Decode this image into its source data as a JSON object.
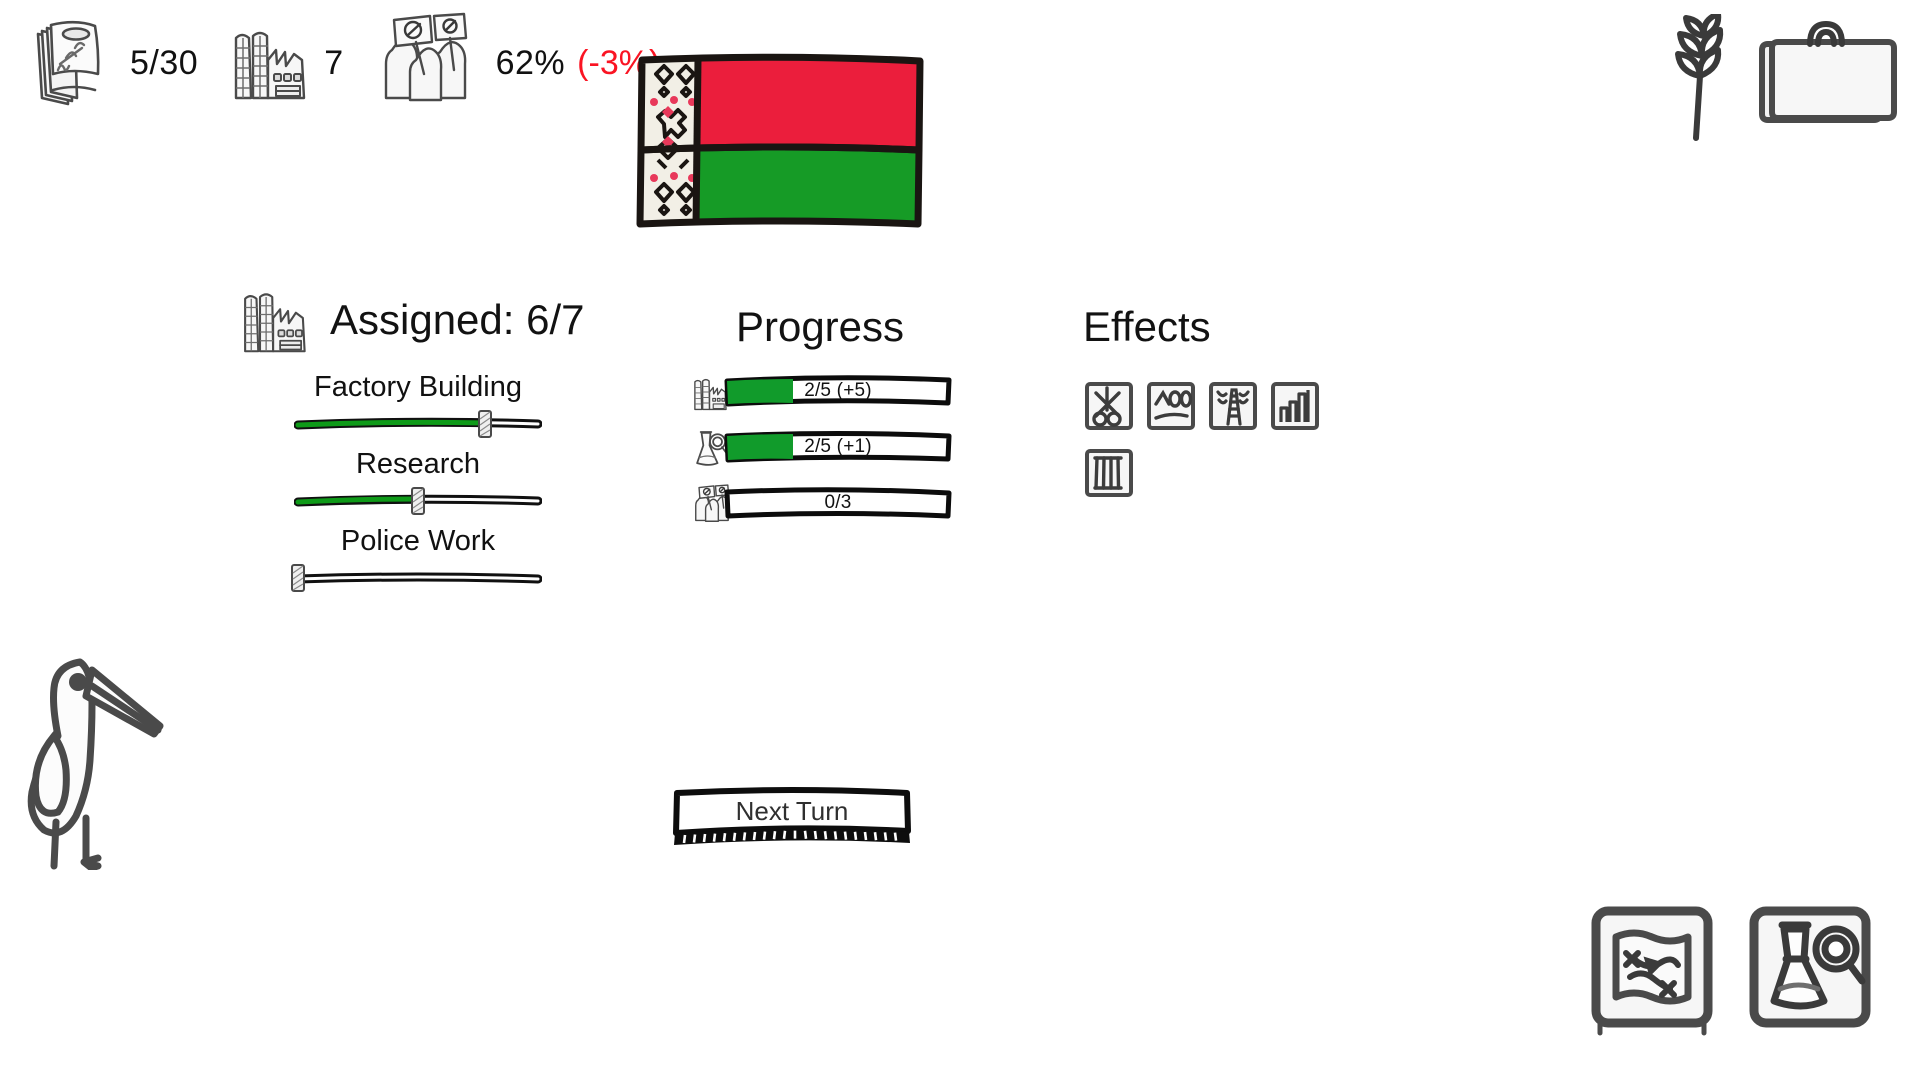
{
  "topbar": {
    "resources": [
      {
        "icon": "money-stack-icon",
        "name": "money",
        "value": "5/30",
        "delta": ""
      },
      {
        "icon": "factory-icon",
        "name": "factories",
        "value": "7",
        "delta": ""
      },
      {
        "icon": "protesters-icon",
        "name": "approval",
        "value": "62%",
        "delta": "(-3%)"
      }
    ],
    "delta_color": "#fa1423"
  },
  "flag": {
    "name": "belarus-flag",
    "red": "#eb1e3c",
    "green": "#169b26",
    "ornament_bg": "#f2efe6",
    "outline": "#1a1512"
  },
  "top_right_icons": [
    {
      "name": "wheat-icon",
      "label": "Agriculture"
    },
    {
      "name": "briefcase-icon",
      "label": "Economy"
    }
  ],
  "assigned": {
    "icon": "factory-icon",
    "title": "Assigned: 6/7",
    "sliders": [
      {
        "name": "factory-building",
        "label": "Factory Building",
        "fill": 0.77
      },
      {
        "name": "research",
        "label": "Research",
        "fill": 0.5
      },
      {
        "name": "police-work",
        "label": "Police Work",
        "fill": 0.0
      }
    ],
    "fill_color": "#0e9a18"
  },
  "progress": {
    "title": "Progress",
    "rows": [
      {
        "name": "factory-progress",
        "icon": "factory-icon",
        "text": "2/5 (+5)",
        "fill": 0.3
      },
      {
        "name": "research-progress",
        "icon": "research-icon",
        "text": "2/5 (+1)",
        "fill": 0.3
      },
      {
        "name": "protest-progress",
        "icon": "protesters-icon",
        "text": "0/3",
        "fill": 0.0
      }
    ],
    "fill_color": "#119b2b"
  },
  "effects": {
    "title": "Effects",
    "items": [
      {
        "name": "effect-scissors-icon",
        "label": "Cuts"
      },
      {
        "name": "effect-hills-icon",
        "label": "Landscape"
      },
      {
        "name": "effect-tower-icon",
        "label": "Tower"
      },
      {
        "name": "effect-industry-icon",
        "label": "Industry"
      },
      {
        "name": "effect-prison-icon",
        "label": "Prison"
      }
    ]
  },
  "stork": {
    "name": "stork-illustration"
  },
  "next_turn": {
    "label": "Next Turn"
  },
  "bottom_right_icons": [
    {
      "name": "map-icon",
      "label": "Map"
    },
    {
      "name": "research-icon",
      "label": "Research"
    }
  ]
}
